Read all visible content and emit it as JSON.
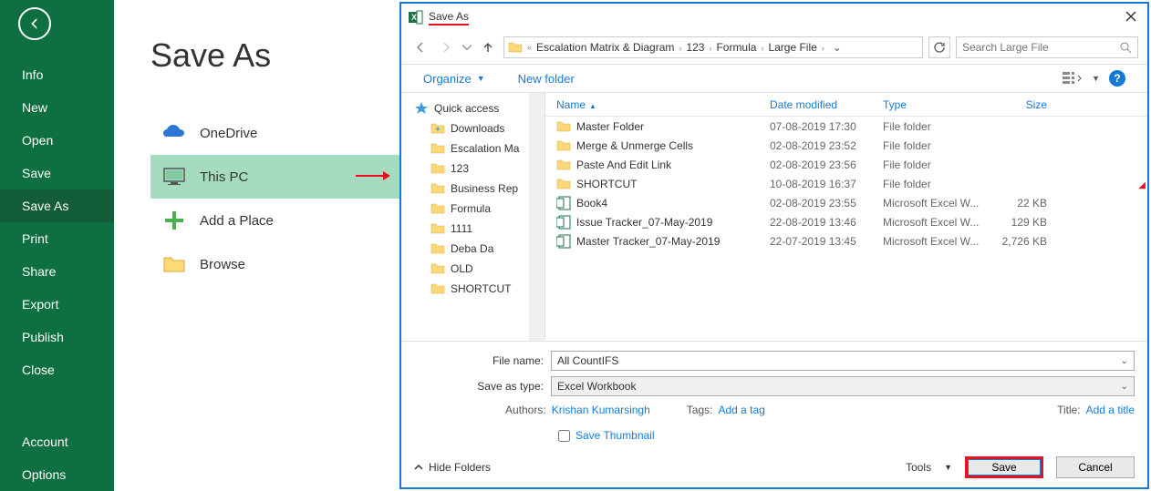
{
  "sidebar": {
    "items": [
      "Info",
      "New",
      "Open",
      "Save",
      "Save As",
      "Print",
      "Share",
      "Export",
      "Publish",
      "Close"
    ],
    "bottom": [
      "Account",
      "Options"
    ],
    "active": "Save As"
  },
  "mid": {
    "title": "Save As",
    "locations": [
      {
        "label": "OneDrive",
        "icon": "onedrive"
      },
      {
        "label": "This PC",
        "icon": "pc",
        "selected": true
      },
      {
        "label": "Add a Place",
        "icon": "add"
      },
      {
        "label": "Browse",
        "icon": "folder"
      }
    ]
  },
  "dialog": {
    "title": "Save As",
    "breadcrumb": [
      "Escalation Matrix & Diagram",
      "123",
      "Formula",
      "Large File"
    ],
    "search_placeholder": "Search Large File",
    "organize": "Organize",
    "newfolder": "New folder",
    "tree": [
      {
        "label": "Quick access",
        "icon": "star",
        "bold": true
      },
      {
        "label": "Downloads",
        "icon": "folder-dl",
        "indent": true,
        "pin": true
      },
      {
        "label": "Escalation Ma",
        "icon": "folder",
        "indent": true,
        "pin": true
      },
      {
        "label": "123",
        "icon": "folder",
        "indent": true,
        "pin": true
      },
      {
        "label": "Business Rep",
        "icon": "folder",
        "indent": true,
        "pin": true
      },
      {
        "label": "Formula",
        "icon": "folder",
        "indent": true,
        "pin": true
      },
      {
        "label": "1111",
        "icon": "folder",
        "indent": true
      },
      {
        "label": "Deba Da",
        "icon": "folder",
        "indent": true
      },
      {
        "label": "OLD",
        "icon": "folder",
        "indent": true
      },
      {
        "label": "SHORTCUT",
        "icon": "folder",
        "indent": true
      }
    ],
    "columns": [
      "Name",
      "Date modified",
      "Type",
      "Size"
    ],
    "files": [
      {
        "name": "Master Folder",
        "date": "07-08-2019 17:30",
        "type": "File folder",
        "size": "",
        "icon": "folder"
      },
      {
        "name": "Merge & Unmerge Cells",
        "date": "02-08-2019 23:52",
        "type": "File folder",
        "size": "",
        "icon": "folder"
      },
      {
        "name": "Paste And Edit Link",
        "date": "02-08-2019 23:56",
        "type": "File folder",
        "size": "",
        "icon": "folder"
      },
      {
        "name": "SHORTCUT",
        "date": "10-08-2019 16:37",
        "type": "File folder",
        "size": "",
        "icon": "folder"
      },
      {
        "name": "Book4",
        "date": "02-08-2019 23:55",
        "type": "Microsoft Excel W...",
        "size": "22 KB",
        "icon": "excel"
      },
      {
        "name": "Issue Tracker_07-May-2019",
        "date": "22-08-2019 13:46",
        "type": "Microsoft Excel W...",
        "size": "129 KB",
        "icon": "excel"
      },
      {
        "name": "Master Tracker_07-May-2019",
        "date": "22-07-2019 13:45",
        "type": "Microsoft Excel W...",
        "size": "2,726 KB",
        "icon": "excel"
      }
    ],
    "filename_label": "File name:",
    "filename_value": "All CountIFS",
    "savetype_label": "Save as type:",
    "savetype_value": "Excel Workbook",
    "authors_label": "Authors:",
    "authors_value": "Krishan Kumarsingh",
    "tags_label": "Tags:",
    "tags_value": "Add a tag",
    "title_label": "Title:",
    "title_value": "Add a title",
    "thumb_label": "Save Thumbnail",
    "hide_folders": "Hide Folders",
    "tools": "Tools",
    "save": "Save",
    "cancel": "Cancel"
  }
}
